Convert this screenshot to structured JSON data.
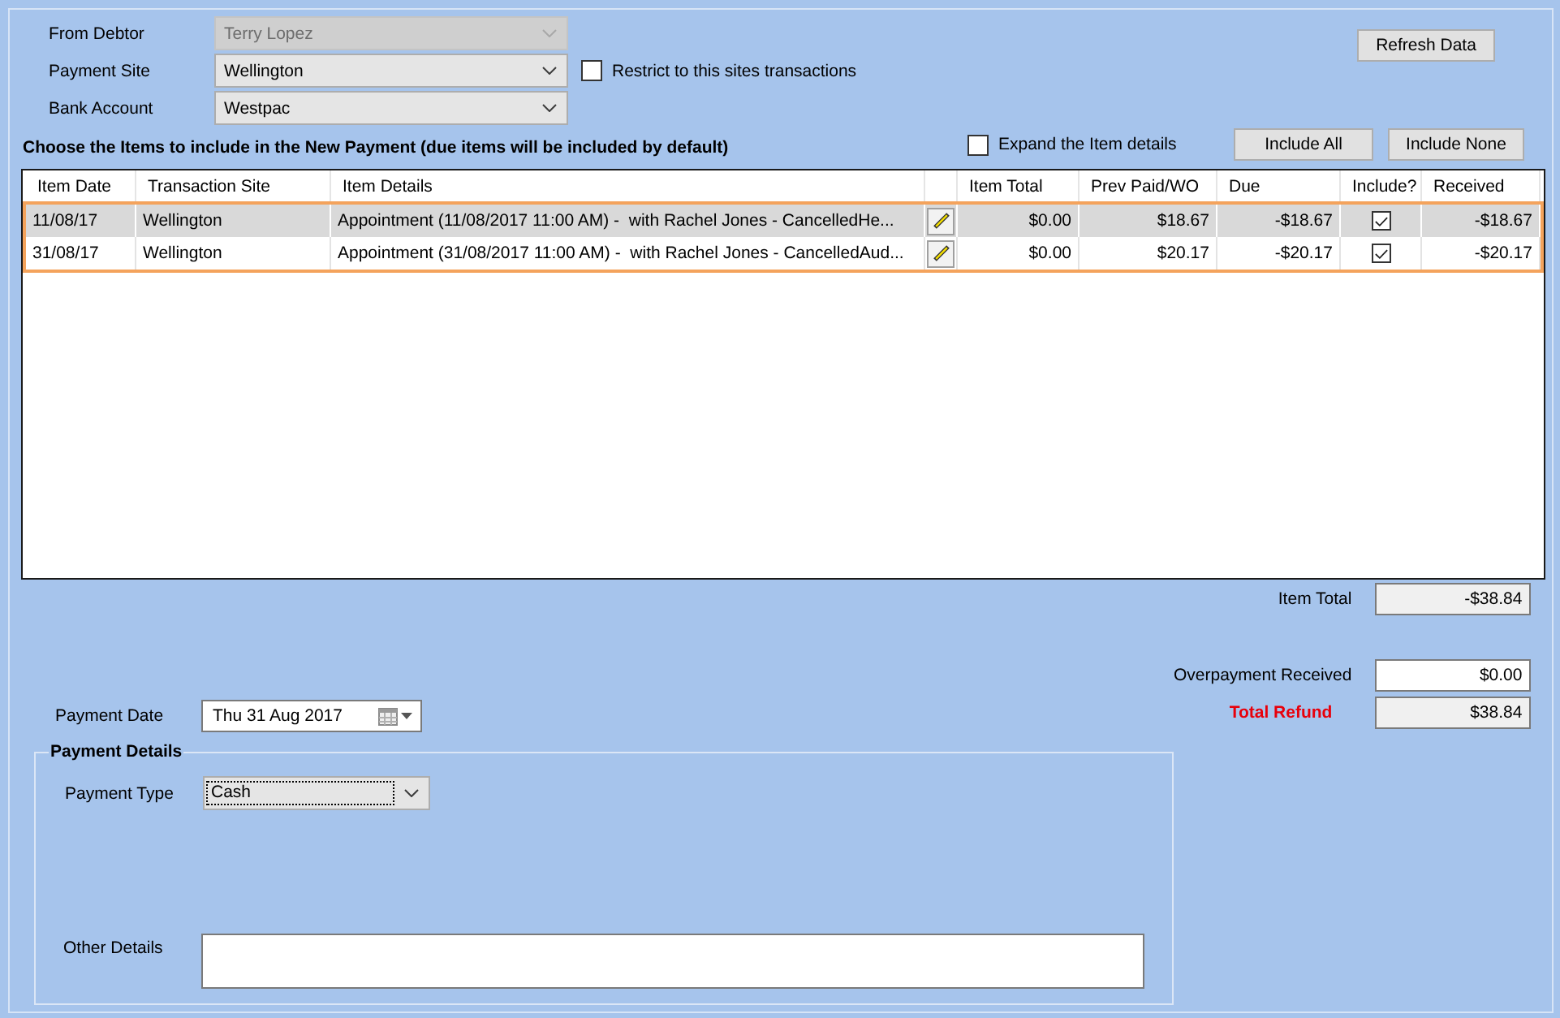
{
  "debtor_form": {
    "fields": [
      {
        "label": "From Debtor",
        "value": "Terry Lopez",
        "disabled": true
      },
      {
        "label": "Payment Site",
        "value": "Wellington",
        "disabled": false,
        "checkbox": {
          "label": "Restrict to this sites transactions",
          "checked": false
        }
      },
      {
        "label": "Bank Account",
        "value": "Westpac",
        "disabled": false
      }
    ],
    "refresh_button": "Refresh Data"
  },
  "items": {
    "heading": "Choose the Items to include in the New Payment (due items will be included by default)",
    "expand_checkbox": {
      "label": "Expand the Item details",
      "checked": false
    },
    "buttons": [
      "Include All",
      "Include None"
    ],
    "table": {
      "columns": [
        {
          "kind": "date",
          "label": "Item Date"
        },
        {
          "kind": "site",
          "label": "Transaction Site"
        },
        {
          "kind": "details",
          "label": "Item Details"
        },
        {
          "kind": "edit"
        },
        {
          "kind": "item_total",
          "label": "Item Total"
        },
        {
          "kind": "prev_paid",
          "label": "Prev Paid/WO"
        },
        {
          "kind": "due",
          "label": "Due"
        },
        {
          "kind": "include",
          "label": "Include?"
        },
        {
          "kind": "received",
          "label": "Received"
        }
      ],
      "rows_outlined": true,
      "rows": [
        {
          "selected": true,
          "date": "11/08/17",
          "site": "Wellington",
          "details": "Appointment (11/08/2017 11:00 AM) -  with Rachel Jones - CancelledHe...",
          "item_total": "$0.00",
          "prev_paid": "$18.67",
          "due": "-$18.67",
          "include": true,
          "received": "-$18.67"
        },
        {
          "selected": false,
          "date": "31/08/17",
          "site": "Wellington",
          "details": "Appointment (31/08/2017 11:00 AM) -  with Rachel Jones - CancelledAud...",
          "item_total": "$0.00",
          "prev_paid": "$20.17",
          "due": "-$20.17",
          "include": true,
          "received": "-$20.17"
        }
      ]
    }
  },
  "totals": [
    {
      "kind": "readonly",
      "label": "Item Total",
      "value": "-$38.84"
    },
    {
      "kind": "input",
      "label": "Overpayment Received",
      "value": "$0.00"
    },
    {
      "kind": "total",
      "label": "Total Refund",
      "value": "$38.84"
    }
  ],
  "payment_date": {
    "label": "Payment Date",
    "value": "Thu 31 Aug 2017"
  },
  "payment_details": {
    "title": "Payment Details",
    "payment_type": {
      "label": "Payment Type",
      "value": "Cash",
      "focused": true
    },
    "other_details": {
      "label": "Other Details"
    }
  }
}
